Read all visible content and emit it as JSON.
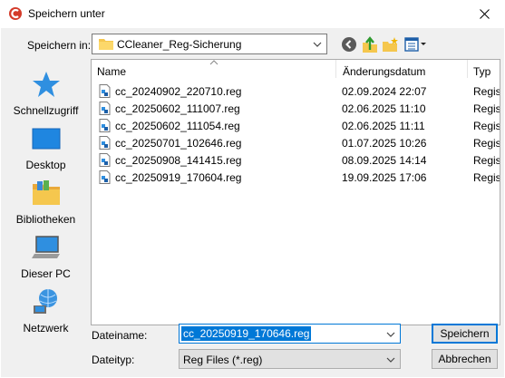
{
  "window": {
    "title": "Speichern unter",
    "close_icon": "close-icon"
  },
  "lookin": {
    "label": "Speichern in:",
    "value": "CCleaner_Reg-Sicherung"
  },
  "toolbar": {
    "icons": [
      "back-icon",
      "up-folder-icon",
      "new-folder-icon",
      "view-menu-icon"
    ]
  },
  "places": [
    {
      "label": "Schnellzugriff",
      "icon": "star-icon"
    },
    {
      "label": "Desktop",
      "icon": "desktop-icon"
    },
    {
      "label": "Bibliotheken",
      "icon": "libraries-icon"
    },
    {
      "label": "Dieser PC",
      "icon": "computer-icon"
    },
    {
      "label": "Netzwerk",
      "icon": "network-icon"
    }
  ],
  "columns": {
    "name": "Name",
    "date": "Änderungsdatum",
    "type": "Typ"
  },
  "files": [
    {
      "name": "cc_20240902_220710.reg",
      "date": "02.09.2024 22:07",
      "type": "Regis"
    },
    {
      "name": "cc_20250602_111007.reg",
      "date": "02.06.2025 11:10",
      "type": "Regis"
    },
    {
      "name": "cc_20250602_111054.reg",
      "date": "02.06.2025 11:11",
      "type": "Regis"
    },
    {
      "name": "cc_20250701_102646.reg",
      "date": "01.07.2025 10:26",
      "type": "Regis"
    },
    {
      "name": "cc_20250908_141415.reg",
      "date": "08.09.2025 14:14",
      "type": "Regis"
    },
    {
      "name": "cc_20250919_170604.reg",
      "date": "19.09.2025 17:06",
      "type": "Regis"
    }
  ],
  "filename": {
    "label": "Dateiname:",
    "value": "cc_20250919_170646.reg"
  },
  "filetype": {
    "label": "Dateityp:",
    "value": "Reg Files (*.reg)"
  },
  "buttons": {
    "save": "Speichern",
    "cancel": "Abbrechen"
  },
  "colors": {
    "accent": "#0078d7",
    "dialog_bg": "#f0f0f0"
  }
}
